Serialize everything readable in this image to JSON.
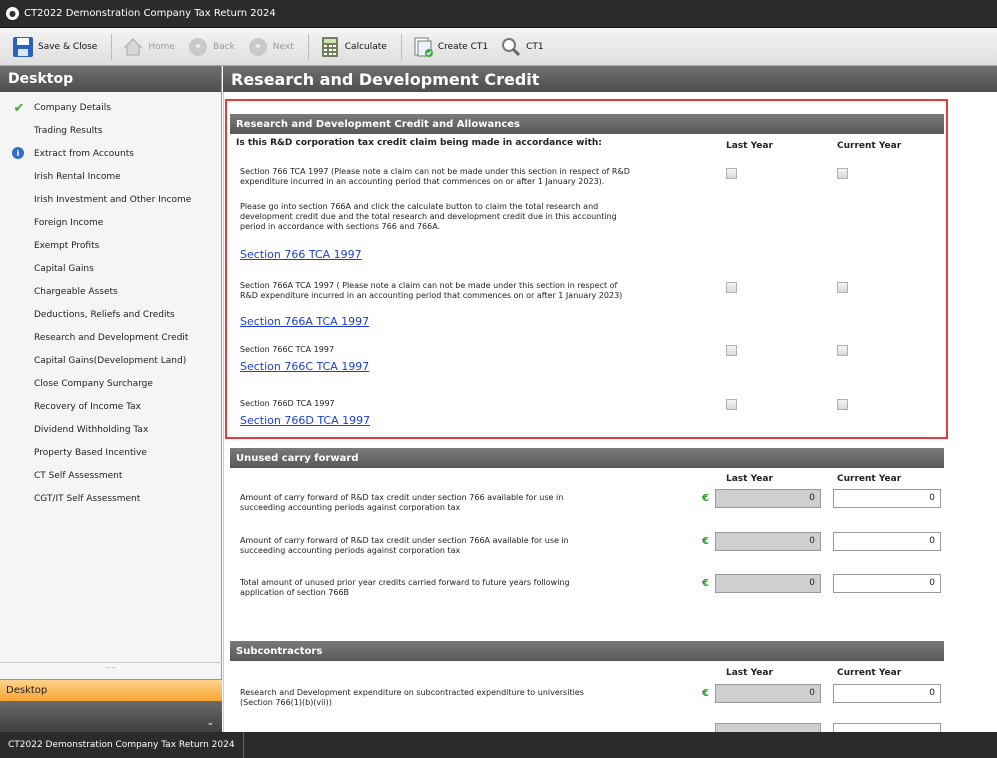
{
  "window": {
    "title": "CT2022 Demonstration Company Tax Return 2024"
  },
  "toolbar": {
    "save_close": "Save & Close",
    "home": "Home",
    "back": "Back",
    "next": "Next",
    "calculate": "Calculate",
    "create_ct1": "Create CT1",
    "ct1": "CT1"
  },
  "sidebar": {
    "title": "Desktop",
    "items": [
      {
        "label": "Company Details",
        "status": "check"
      },
      {
        "label": "Trading Results",
        "status": ""
      },
      {
        "label": "Extract from Accounts",
        "status": "info"
      },
      {
        "label": "Irish Rental Income",
        "status": ""
      },
      {
        "label": "Irish Investment and Other Income",
        "status": ""
      },
      {
        "label": "Foreign Income",
        "status": ""
      },
      {
        "label": "Exempt Profits",
        "status": ""
      },
      {
        "label": "Capital Gains",
        "status": ""
      },
      {
        "label": "Chargeable Assets",
        "status": ""
      },
      {
        "label": "Deductions, Reliefs and Credits",
        "status": ""
      },
      {
        "label": "Research and Development Credit",
        "status": ""
      },
      {
        "label": "Capital Gains(Development Land)",
        "status": ""
      },
      {
        "label": "Close Company Surcharge",
        "status": ""
      },
      {
        "label": "Recovery of Income Tax",
        "status": ""
      },
      {
        "label": "Dividend Withholding Tax",
        "status": ""
      },
      {
        "label": "Property Based Incentive",
        "status": ""
      },
      {
        "label": "CT Self Assessment",
        "status": ""
      },
      {
        "label": "CGT/IT Self Assessment",
        "status": ""
      }
    ],
    "grip": "....",
    "bottom_tab": "Desktop"
  },
  "page": {
    "title": "Research and Development Credit"
  },
  "rd_section": {
    "header": "Research and Development Credit  and Allowances",
    "question": "Is this R&D corporation tax credit claim being made in accordance with:",
    "last_year": "Last Year",
    "current_year": "Current Year",
    "row1": {
      "line1": "Section 766 TCA 1997 (Please note a claim can not be made under this section in respect of R&D",
      "line2": "expenditure incurred in an accounting period that commences on or after 1 January 2023)."
    },
    "note": {
      "line1": "Please go into section 766A and click the calculate button to claim the total research and",
      "line2": "development credit due and the total research and development credit due in this accounting",
      "line3": "period in accordance with sections 766 and 766A."
    },
    "link1": "Section 766 TCA 1997",
    "row2": {
      "line1": "Section 766A TCA 1997 ( Please note a claim can not be made under this section in respect of",
      "line2": "R&D expenditure incurred in an accounting period that commences on or after 1 January 2023)"
    },
    "link2": "Section 766A TCA 1997",
    "row3": "Section 766C TCA 1997",
    "link3": "Section 766C TCA 1997",
    "row4": "Section 766D TCA 1997",
    "link4": "Section 766D TCA 1997"
  },
  "carry_section": {
    "header": "Unused carry forward",
    "last_year": "Last Year",
    "current_year": "Current Year",
    "currency": "€",
    "rows": [
      {
        "line1": "Amount of carry forward of R&D tax credit under section 766 available for use in",
        "line2": "succeeding accounting periods against corporation tax",
        "last": "0",
        "current": "0"
      },
      {
        "line1": "Amount of carry forward of R&D tax credit under section 766A available for use in",
        "line2": "succeeding accounting periods against corporation tax",
        "last": "0",
        "current": "0"
      },
      {
        "line1": "Total amount of unused prior year credits carried forward to future years following",
        "line2": "application of section 766B",
        "last": "0",
        "current": "0"
      }
    ]
  },
  "sub_section": {
    "header": "Subcontractors",
    "last_year": "Last Year",
    "current_year": "Current Year",
    "currency": "€",
    "rows": [
      {
        "line1": "Research and Development expenditure on subcontracted expenditure to universities",
        "line2": "(Section 766(1)(b)(vii))",
        "last": "0",
        "current": "0"
      }
    ]
  },
  "statusbar": {
    "tab": "CT2022 Demonstration Company Tax Return 2024"
  }
}
